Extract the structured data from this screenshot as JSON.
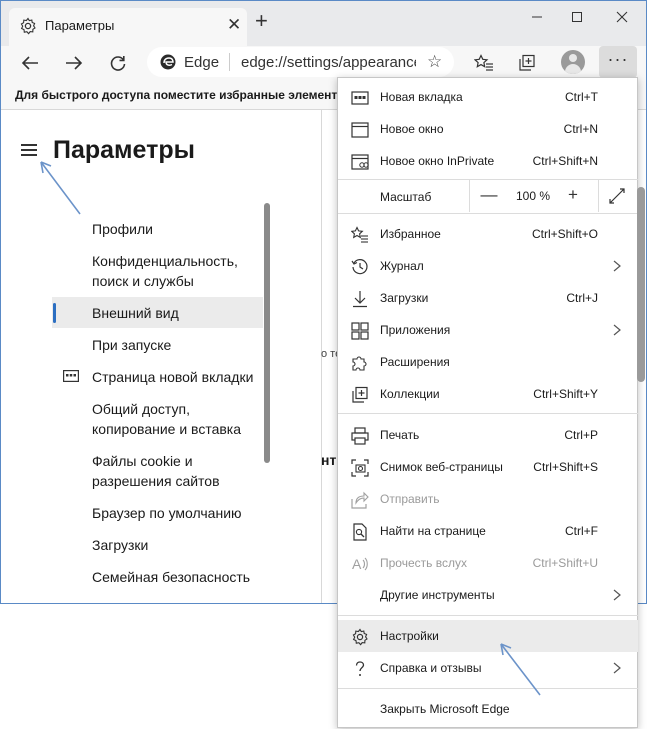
{
  "tab": {
    "title": "Параметры",
    "close": "✕",
    "new_tab": "+"
  },
  "window_controls": {
    "minimize": "—",
    "maximize": "☐",
    "close": "✕"
  },
  "address": {
    "brand": "Edge",
    "url": "edge://settings/appearance"
  },
  "favorites_bar": {
    "text": "Для быстрого доступа поместите избранные элементы на панель избранного."
  },
  "settings": {
    "title": "Параметры",
    "nav": [
      "Профили",
      "Конфиденциальность,",
      "поиск и службы",
      "Внешний вид",
      "При запуске",
      "Страница новой вкладки",
      "Общий доступ,",
      "копирование и вставка",
      "Файлы cookie и",
      "разрешения сайтов",
      "Браузер по умолчанию",
      "Загрузки",
      "Семейная безопасность"
    ],
    "content_fragments": [
      "о те",
      "нт"
    ]
  },
  "menu": {
    "new_tab": {
      "label": "Новая вкладка",
      "shortcut": "Ctrl+T"
    },
    "new_window": {
      "label": "Новое окно",
      "shortcut": "Ctrl+N"
    },
    "new_inprivate": {
      "label": "Новое окно InPrivate",
      "shortcut": "Ctrl+Shift+N"
    },
    "zoom": {
      "label": "Масштаб",
      "minus": "—",
      "value": "100 %",
      "plus": "+"
    },
    "favorites": {
      "label": "Избранное",
      "shortcut": "Ctrl+Shift+O"
    },
    "history": {
      "label": "Журнал"
    },
    "downloads": {
      "label": "Загрузки",
      "shortcut": "Ctrl+J"
    },
    "apps": {
      "label": "Приложения"
    },
    "extensions": {
      "label": "Расширения"
    },
    "collections": {
      "label": "Коллекции",
      "shortcut": "Ctrl+Shift+Y"
    },
    "print": {
      "label": "Печать",
      "shortcut": "Ctrl+P"
    },
    "screenshot": {
      "label": "Снимок веб-страницы",
      "shortcut": "Ctrl+Shift+S"
    },
    "share": {
      "label": "Отправить"
    },
    "find": {
      "label": "Найти на странице",
      "shortcut": "Ctrl+F"
    },
    "read_aloud": {
      "label": "Прочесть вслух",
      "shortcut": "Ctrl+Shift+U"
    },
    "more_tools": {
      "label": "Другие инструменты"
    },
    "settings": {
      "label": "Настройки"
    },
    "help": {
      "label": "Справка и отзывы"
    },
    "close": {
      "label": "Закрыть Microsoft Edge"
    }
  },
  "colors": {
    "accent": "#2c6fc2",
    "annotation_arrow": "#6b93c9",
    "window_border": "#5a8ac6"
  }
}
